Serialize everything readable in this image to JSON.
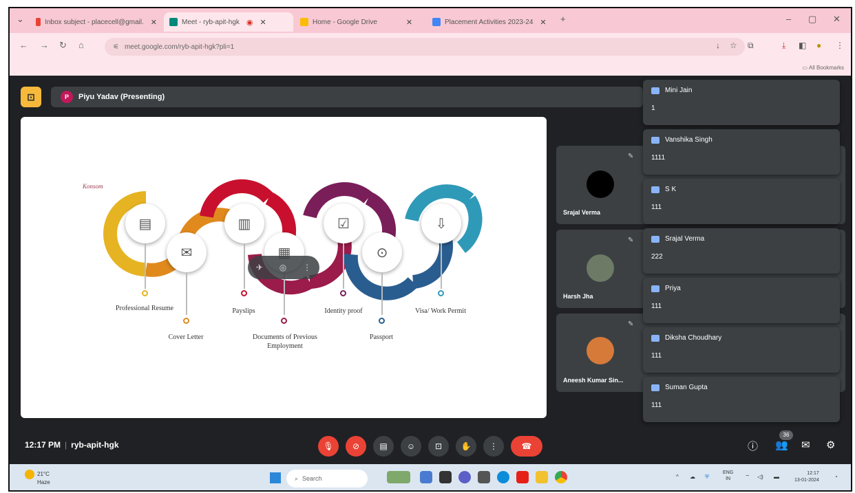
{
  "browser": {
    "tabs": [
      {
        "label": "Inbox subject - placecell@gmail.",
        "icon": "gmail-icon"
      },
      {
        "label": "Meet - ryb-apit-hgk",
        "icon": "meet-icon"
      },
      {
        "label": "Home - Google Drive",
        "icon": "drive-icon"
      },
      {
        "label": "Placement Activities 2023-24",
        "icon": "docs-icon"
      }
    ],
    "new_tab": "+",
    "url": "meet.google.com/ryb-apit-hgk?pli=1",
    "bookmarks_label": "All Bookmarks"
  },
  "meet": {
    "presenter_initial": "P",
    "presenter_label": "Piyu Yadav (Presenting)",
    "meeting_time": "12:17 PM",
    "meeting_code": "ryb-apit-hgk",
    "participant_count": "36"
  },
  "slide": {
    "brand": "Konsom",
    "steps": [
      {
        "label": "Professional Resume",
        "color": "#e6b422"
      },
      {
        "label": "Cover Letter",
        "color": "#e08a1e"
      },
      {
        "label": "Payslips",
        "color": "#c8102e"
      },
      {
        "label": "Documents of Previous Employment",
        "color": "#9b1b4a"
      },
      {
        "label": "Identity proof",
        "color": "#7a1e5a"
      },
      {
        "label": "Passport",
        "color": "#2a5d8f"
      },
      {
        "label": "Visa/ Work Permit",
        "color": "#2f9ab8"
      }
    ]
  },
  "tiles": [
    {
      "name": "Srajal Verma"
    },
    {
      "name": "Harsh Jha"
    },
    {
      "name": "Aneesh Kumar Sin..."
    }
  ],
  "chat": [
    {
      "sender": "Mini Jain",
      "message": "1"
    },
    {
      "sender": "Vanshika Singh",
      "message": "1111"
    },
    {
      "sender": "S K",
      "message": "111"
    },
    {
      "sender": "Srajal Verma",
      "message": "222"
    },
    {
      "sender": "Priya",
      "message": "111"
    },
    {
      "sender": "Diksha Choudhary",
      "message": "111"
    },
    {
      "sender": "Suman Gupta",
      "message": "111"
    }
  ],
  "taskbar": {
    "weather_temp": "21°C",
    "weather_desc": "Haze",
    "search_placeholder": "Search",
    "lang_line1": "ENG",
    "lang_line2": "IN",
    "time": "12:17",
    "date": "13-01-2024"
  }
}
